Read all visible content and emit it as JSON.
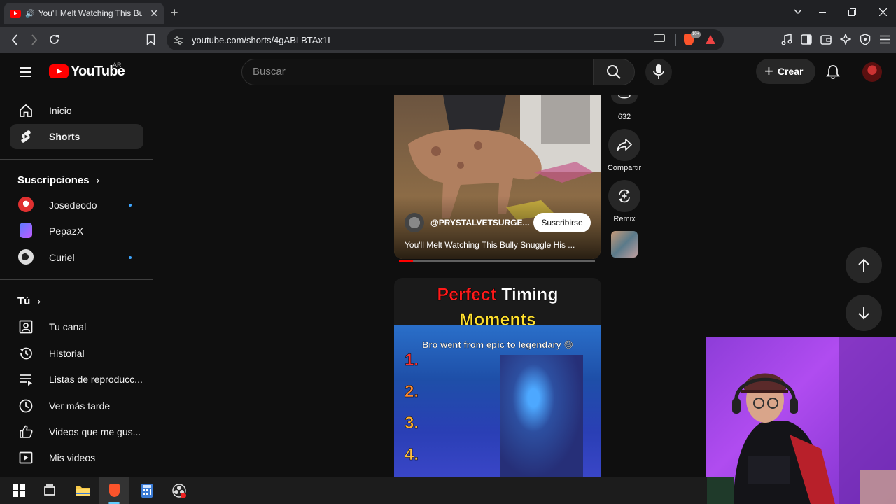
{
  "browser": {
    "tab_title": "You'll Melt Watching This Bully Snuggle His Tiny",
    "url": "youtube.com/shorts/4gABLBTAx1I",
    "brave_badge": "10+"
  },
  "header": {
    "logo_text": "YouTube",
    "region": "AR",
    "search_placeholder": "Buscar",
    "create_label": "Crear"
  },
  "sidebar": {
    "main": [
      {
        "label": "Inicio",
        "icon": "home-icon"
      },
      {
        "label": "Shorts",
        "icon": "shorts-icon",
        "active": true
      }
    ],
    "subscriptions_title": "Suscripciones",
    "subscriptions": [
      {
        "label": "Josedeodo",
        "new_content": true
      },
      {
        "label": "PepazX",
        "new_content": false
      },
      {
        "label": "Curiel",
        "new_content": true
      }
    ],
    "you_title": "Tú",
    "you": [
      {
        "label": "Tu canal",
        "icon": "channel-icon"
      },
      {
        "label": "Historial",
        "icon": "history-icon"
      },
      {
        "label": "Listas de reproducc...",
        "icon": "playlist-icon"
      },
      {
        "label": "Ver más tarde",
        "icon": "clock-icon"
      },
      {
        "label": "Videos que me gus...",
        "icon": "like-icon"
      },
      {
        "label": "Mis videos",
        "icon": "video-icon"
      }
    ]
  },
  "short_current": {
    "channel": "@PRYSTALVETSURGE...",
    "subscribe_label": "Suscribirse",
    "title": "You'll Melt Watching This Bully Snuggle His ...",
    "progress": 0.07
  },
  "actions": {
    "comments_count": "632",
    "share_label": "Compartir",
    "remix_label": "Remix"
  },
  "short_next": {
    "headline_red": "Perfect",
    "headline_white": "Timing",
    "headline_yellow": "Moments",
    "caption": "Bro went from epic to legendary 😅",
    "ranks": [
      "1.",
      "2.",
      "3.",
      "4."
    ]
  }
}
